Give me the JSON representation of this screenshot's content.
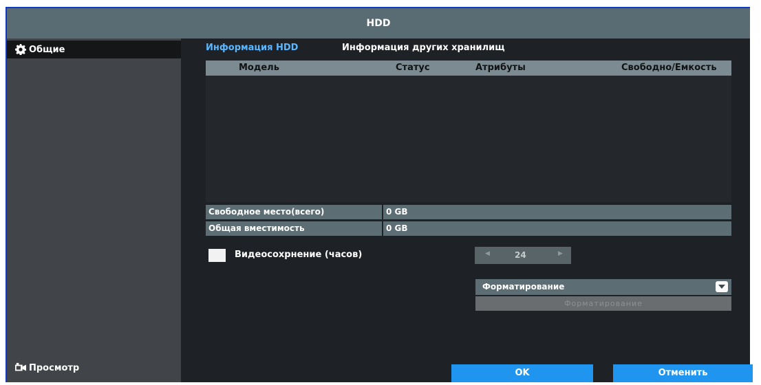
{
  "window": {
    "title": "HDD"
  },
  "sidebar": {
    "items": [
      {
        "label": "Общие",
        "icon": "gear-icon"
      },
      {
        "label": "Просмотр",
        "icon": "camera-icon"
      }
    ]
  },
  "tabs": [
    {
      "label": "Информация HDD",
      "active": true
    },
    {
      "label": "Информация других хранилищ",
      "active": false
    }
  ],
  "table": {
    "columns": [
      "Модель",
      "Статус",
      "Атрибуты",
      "Свободно/Емкость"
    ],
    "rows": []
  },
  "info": {
    "free_space_label": "Свободное место(всего)",
    "free_space_value": "0 GB",
    "total_capacity_label": "Общая вместимость",
    "total_capacity_value": "0 GB"
  },
  "retention": {
    "label": "Видеосохрнение (часов)",
    "checked": false,
    "value": "24"
  },
  "format": {
    "select_value": "Форматирование",
    "button_label": "Форматирование"
  },
  "actions": {
    "ok": "OK",
    "cancel": "Отменить"
  },
  "colors": {
    "accent": "#1f95f0",
    "active_tab": "#5ab7ff",
    "title_bar": "#596b73"
  }
}
